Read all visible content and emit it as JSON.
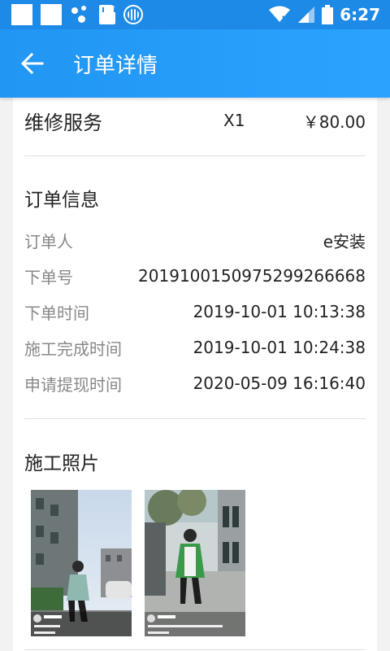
{
  "statusbar": {
    "time": "6:27"
  },
  "toolbar": {
    "title": "订单详情"
  },
  "service": {
    "name": "维修服务",
    "qty": "X1",
    "price": "￥80.00"
  },
  "order_info": {
    "title": "订单信息",
    "rows": [
      {
        "label": "订单人",
        "value": "e安装"
      },
      {
        "label": "下单号",
        "value": "20191001509752992666​68"
      },
      {
        "label": "下单时间",
        "value": "2019-10-01 10:13:38"
      },
      {
        "label": "施工完成时间",
        "value": "2019-10-01 10:24:38"
      },
      {
        "label": "申请提现时间",
        "value": "2020-05-09 16:16:40"
      }
    ]
  },
  "photos": {
    "title": "施工照片"
  },
  "colors": {
    "primary": "#2196f3",
    "statusbar": "#1e8ae8"
  }
}
